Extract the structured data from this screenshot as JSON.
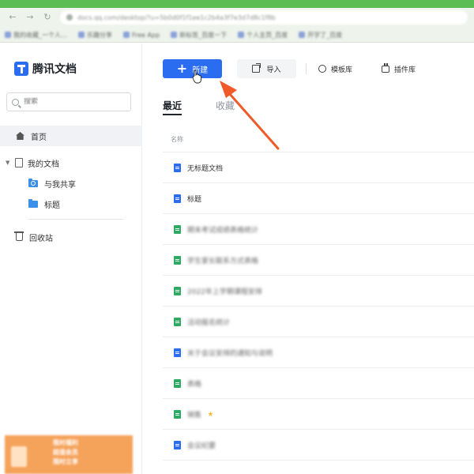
{
  "browser": {
    "url": "docs.qq.com/desktop/?u=5b0d0f1f1ee1c2b4a3f7e3d7d8c1f8b",
    "bookmarks": [
      "我的收藏_一个人…",
      "乐趣分享",
      "Free App",
      "新标签_百度一下",
      "个人主页_百度",
      "开学了_百度"
    ]
  },
  "sidebar": {
    "app_name": "腾讯文档",
    "search_placeholder": "搜索",
    "home": "首页",
    "my_docs": "我的文档",
    "shared_with_me": "与我共享",
    "folder_title": "标题",
    "trash": "回收站",
    "promo_lines": [
      "限时福利",
      "超值会员",
      "限时立享"
    ]
  },
  "toolbar": {
    "new_label": "新建",
    "import_label": "导入",
    "template_label": "模板库",
    "plugin_label": "插件库"
  },
  "tabs": {
    "recent": "最近",
    "favorites": "收藏"
  },
  "list": {
    "column_name": "名称",
    "files": [
      {
        "name": "无标题文档",
        "type": "doc",
        "blurred": false,
        "starred": false
      },
      {
        "name": "标题",
        "type": "doc",
        "blurred": false,
        "starred": false
      },
      {
        "name": "期末考试成绩表格统计",
        "type": "sheet",
        "blurred": true,
        "starred": false
      },
      {
        "name": "学生家长联系方式表格",
        "type": "sheet",
        "blurred": true,
        "starred": false
      },
      {
        "name": "2022年上学期课程安排",
        "type": "sheet",
        "blurred": true,
        "starred": false
      },
      {
        "name": "活动报名统计",
        "type": "sheet",
        "blurred": true,
        "starred": false
      },
      {
        "name": "关于会议安排的通知与说明",
        "type": "doc",
        "blurred": true,
        "starred": false
      },
      {
        "name": "表格",
        "type": "sheet",
        "blurred": true,
        "starred": false
      },
      {
        "name": "销售",
        "type": "sheet",
        "blurred": true,
        "starred": true
      },
      {
        "name": "会议纪要",
        "type": "doc",
        "blurred": true,
        "starred": false
      }
    ]
  },
  "colors": {
    "accent": "#2b6df0",
    "sheet": "#2dab63",
    "annotation_arrow": "#f05a28",
    "browser_tab_bar": "#5bbd54"
  }
}
